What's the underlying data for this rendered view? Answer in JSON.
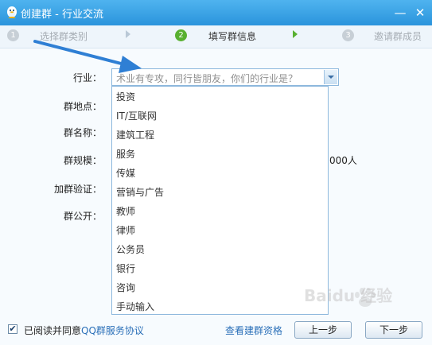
{
  "window": {
    "title": "创建群 - 行业交流"
  },
  "titlebar_buttons": {
    "minimize": "—",
    "close": "✕"
  },
  "steps": [
    {
      "number": "1",
      "label": "选择群类别"
    },
    {
      "number": "2",
      "label": "填写群信息"
    },
    {
      "number": "3",
      "label": "邀请群成员"
    }
  ],
  "form": {
    "labels": {
      "industry": "行业：",
      "location": "群地点：",
      "name": "群名称：",
      "size": "群规模：",
      "verify": "加群验证：",
      "public": "群公开："
    },
    "industry_placeholder": "术业有专攻，同行皆朋友，你们的行业是？",
    "size_partial_text": "000人"
  },
  "dropdown": {
    "options": [
      "投资",
      "IT/互联网",
      "建筑工程",
      "服务",
      "传媒",
      "营销与广告",
      "教师",
      "律师",
      "公务员",
      "银行",
      "咨询",
      "手动输入"
    ]
  },
  "footer": {
    "agree_prefix": "已阅读并同意",
    "agree_link": "QQ群服务协议",
    "checked_mark": "✔",
    "view_qualification": "查看建群资格",
    "prev": "上一步",
    "next": "下一步"
  },
  "watermark": {
    "text": "Baidu 经验"
  },
  "colors": {
    "titlebar": "#2a94dc",
    "step_active": "#58b030",
    "link": "#2a6fb8",
    "annotation_arrow": "#2f7fd4"
  }
}
